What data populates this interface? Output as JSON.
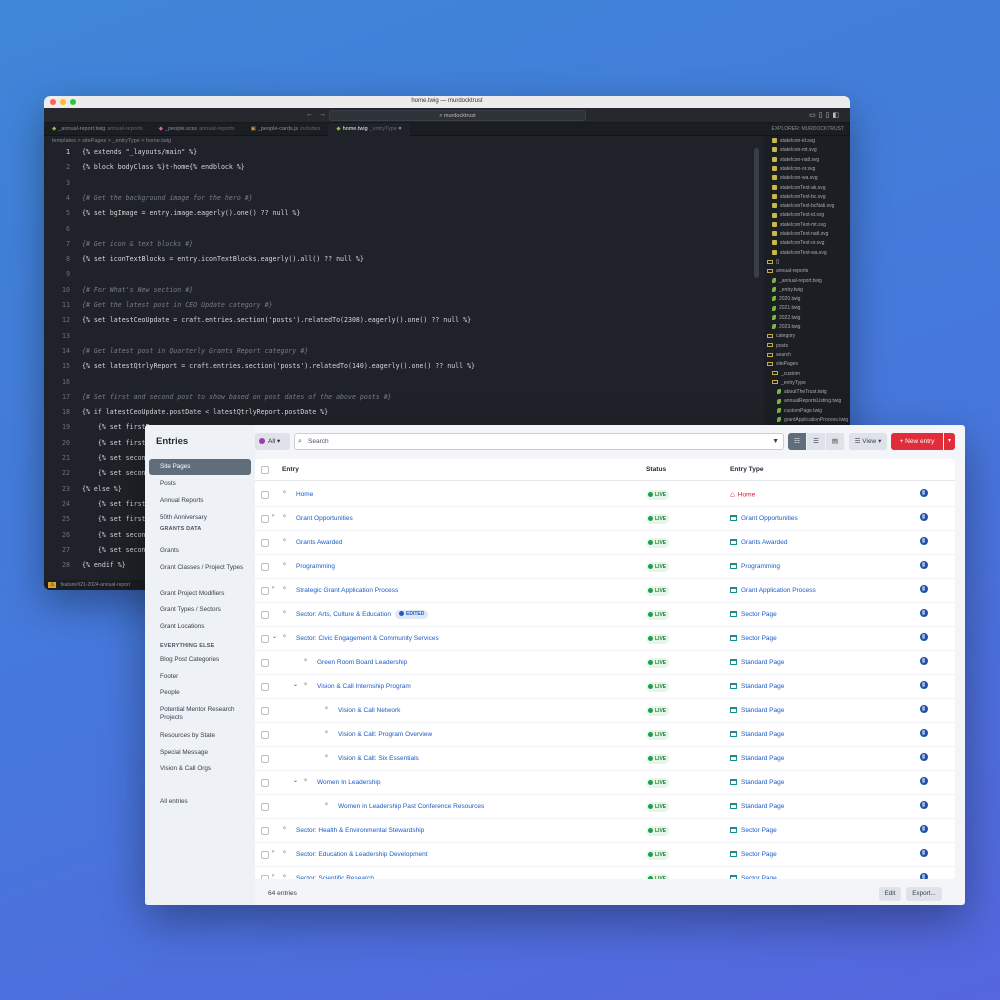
{
  "editor": {
    "window_title": "home.twig — murdocktrust",
    "search_text": "murdocktrust",
    "tabs": [
      {
        "name": "_annual-report.twig",
        "sub": "annual-reports"
      },
      {
        "name": "_people.scss",
        "sub": "annual-reports"
      },
      {
        "name": "_people-cards.js",
        "sub": "includes"
      },
      {
        "name": "home.twig",
        "sub": "_entryType"
      }
    ],
    "explorer_title": "EXPLORER: MURDOCKTRUST",
    "breadcrumb": "templates > sitePages > _entryType > home.twig",
    "code_lines": [
      {
        "n": "1",
        "t": "{% extends \"_layouts/main\" %}"
      },
      {
        "n": "2",
        "t": "{% block bodyClass %}t-home{% endblock %}"
      },
      {
        "n": "3",
        "t": ""
      },
      {
        "n": "4",
        "t": "{# Get the background image for the hero #}"
      },
      {
        "n": "5",
        "t": "{% set bgImage = entry.image.eagerly().one() ?? null %}"
      },
      {
        "n": "6",
        "t": ""
      },
      {
        "n": "7",
        "t": "{# Get icon & text blocks #}"
      },
      {
        "n": "8",
        "t": "{% set iconTextBlocks = entry.iconTextBlocks.eagerly().all() ?? null %}"
      },
      {
        "n": "9",
        "t": ""
      },
      {
        "n": "10",
        "t": "{# For What's New section #}"
      },
      {
        "n": "11",
        "t": "{# Get the latest post in CEO Update category #}"
      },
      {
        "n": "12",
        "t": "{% set latestCeoUpdate = craft.entries.section('posts').relatedTo(2308).eagerly().one() ?? null %}"
      },
      {
        "n": "13",
        "t": ""
      },
      {
        "n": "14",
        "t": "{# Get latest post in Quarterly Grants Report category #}"
      },
      {
        "n": "15",
        "t": "{% set latestQtrlyReport = craft.entries.section('posts').relatedTo(140).eagerly().one() ?? null %}"
      },
      {
        "n": "16",
        "t": ""
      },
      {
        "n": "17",
        "t": "{# Set first and second post to show based on post dates of the above posts #}"
      },
      {
        "n": "18",
        "t": "{% if latestCeoUpdate.postDate < latestQtrlyReport.postDate %}"
      },
      {
        "n": "19",
        "t": "    {% set firstP"
      },
      {
        "n": "20",
        "t": "    {% set firstP"
      },
      {
        "n": "21",
        "t": "    {% set second"
      },
      {
        "n": "22",
        "t": "    {% set second"
      },
      {
        "n": "23",
        "t": "{% else %}"
      },
      {
        "n": "24",
        "t": "    {% set firstP"
      },
      {
        "n": "25",
        "t": "    {% set firstP"
      },
      {
        "n": "26",
        "t": "    {% set second"
      },
      {
        "n": "27",
        "t": "    {% set second"
      },
      {
        "n": "28",
        "t": "{% endif %}"
      }
    ],
    "explorer_items": [
      {
        "label": "stateIcon-id.svg",
        "kind": "svg",
        "indent": 1
      },
      {
        "label": "stateIcon-mt.svg",
        "kind": "svg",
        "indent": 1
      },
      {
        "label": "stateIcon-natl.svg",
        "kind": "svg",
        "indent": 1
      },
      {
        "label": "stateIcon-or.svg",
        "kind": "svg",
        "indent": 1
      },
      {
        "label": "stateIcon-wa.svg",
        "kind": "svg",
        "indent": 1
      },
      {
        "label": "stateIconText-ak.svg",
        "kind": "svg",
        "indent": 1
      },
      {
        "label": "stateIconText-bc.svg",
        "kind": "svg",
        "indent": 1
      },
      {
        "label": "stateIconText-bcNati.svg",
        "kind": "svg",
        "indent": 1
      },
      {
        "label": "stateIconText-id.svg",
        "kind": "svg",
        "indent": 1
      },
      {
        "label": "stateIconText-mt.svg",
        "kind": "svg",
        "indent": 1
      },
      {
        "label": "stateIconText-natl.svg",
        "kind": "svg",
        "indent": 1
      },
      {
        "label": "stateIconText-or.svg",
        "kind": "svg",
        "indent": 1
      },
      {
        "label": "stateIconText-wa.svg",
        "kind": "svg",
        "indent": 1
      },
      {
        "label": "{}",
        "kind": "code",
        "indent": 0
      },
      {
        "label": "annual-reports",
        "kind": "folder",
        "indent": 0
      },
      {
        "label": "_annual-report.twig",
        "kind": "twig",
        "indent": 1
      },
      {
        "label": "_entry.twig",
        "kind": "twig",
        "indent": 1
      },
      {
        "label": "2020.twig",
        "kind": "twig",
        "indent": 1
      },
      {
        "label": "2021.twig",
        "kind": "twig",
        "indent": 1
      },
      {
        "label": "2022.twig",
        "kind": "twig",
        "indent": 1
      },
      {
        "label": "2023.twig",
        "kind": "twig",
        "indent": 1
      },
      {
        "label": "category",
        "kind": "folder",
        "indent": 0
      },
      {
        "label": "posts",
        "kind": "folder",
        "indent": 0
      },
      {
        "label": "search",
        "kind": "folder",
        "indent": 0
      },
      {
        "label": "sitePages",
        "kind": "folder",
        "indent": 0
      },
      {
        "label": "_custom",
        "kind": "folder",
        "indent": 1
      },
      {
        "label": "_entryType",
        "kind": "folder",
        "indent": 1
      },
      {
        "label": "aboutTheTrust.twig",
        "kind": "twig",
        "indent": 2
      },
      {
        "label": "annualReportsListing.twig",
        "kind": "twig",
        "indent": 2
      },
      {
        "label": "customPage.twig",
        "kind": "twig",
        "indent": 2
      },
      {
        "label": "grantApplicationProcess.twig",
        "kind": "twig",
        "indent": 2
      }
    ],
    "status_text": "feature/#21-2024-annual-report"
  },
  "cms": {
    "title": "Entries",
    "sidebar": {
      "items": [
        {
          "label": "Site Pages",
          "selected": true
        },
        {
          "label": "Posts"
        },
        {
          "label": "Annual Reports"
        },
        {
          "label": "50th Anniversary"
        }
      ],
      "group1_heading": "GRANTS DATA",
      "group1": [
        {
          "label": "Grants"
        },
        {
          "label": "Grant Classes / Project Types"
        },
        {
          "label": "Grant Project Modifiers"
        },
        {
          "label": "Grant Types / Sectors"
        },
        {
          "label": "Grant Locations"
        }
      ],
      "group2_heading": "EVERYTHING ELSE",
      "group2": [
        {
          "label": "Blog Post Categories"
        },
        {
          "label": "Footer"
        },
        {
          "label": "People"
        },
        {
          "label": "Potential Mentor Research Projects"
        },
        {
          "label": "Resources by State"
        },
        {
          "label": "Special Message"
        },
        {
          "label": "Vision & Call Orgs"
        }
      ],
      "all_entries": "All entries"
    },
    "toolbar": {
      "site_filter": "All",
      "search_placeholder": "Search",
      "view_label": "View",
      "new_entry_label": "New entry"
    },
    "table": {
      "columns": {
        "entry": "Entry",
        "status": "Status",
        "type": "Entry Type"
      },
      "rows": [
        {
          "title": "Home",
          "level": 0,
          "expand": "",
          "status": "LIVE",
          "type": "Home",
          "home": true
        },
        {
          "title": "Grant Opportunities",
          "level": 0,
          "expand": "›",
          "status": "LIVE",
          "type": "Grant Opportunities"
        },
        {
          "title": "Grants Awarded",
          "level": 0,
          "expand": "",
          "status": "LIVE",
          "type": "Grants Awarded"
        },
        {
          "title": "Programming",
          "level": 0,
          "expand": "",
          "status": "LIVE",
          "type": "Programming"
        },
        {
          "title": "Strategic Grant Application Process",
          "level": 0,
          "expand": "›",
          "status": "LIVE",
          "type": "Grant Application Process"
        },
        {
          "title": "Sector: Arts, Culture & Education",
          "level": 0,
          "expand": "",
          "status": "LIVE",
          "type": "Sector Page",
          "edited": "EDITED"
        },
        {
          "title": "Sector: Civic Engagement & Community Services",
          "level": 0,
          "expand": "⌄",
          "status": "LIVE",
          "type": "Sector Page"
        },
        {
          "title": "Green Room Board Leadership",
          "level": 1,
          "expand": "",
          "status": "LIVE",
          "type": "Standard Page"
        },
        {
          "title": "Vision & Call Internship Program",
          "level": 1,
          "expand": "⌄",
          "status": "LIVE",
          "type": "Standard Page"
        },
        {
          "title": "Vision & Call Network",
          "level": 2,
          "expand": "",
          "status": "LIVE",
          "type": "Standard Page"
        },
        {
          "title": "Vision & Call: Program Overview",
          "level": 2,
          "expand": "",
          "status": "LIVE",
          "type": "Standard Page"
        },
        {
          "title": "Vision & Call: Six Essentials",
          "level": 2,
          "expand": "",
          "status": "LIVE",
          "type": "Standard Page"
        },
        {
          "title": "Women In Leadership",
          "level": 1,
          "expand": "⌄",
          "status": "LIVE",
          "type": "Standard Page"
        },
        {
          "title": "Women in Leadership Past Conference Resources",
          "level": 2,
          "expand": "",
          "status": "LIVE",
          "type": "Standard Page"
        },
        {
          "title": "Sector: Health & Environmental Stewardship",
          "level": 0,
          "expand": "",
          "status": "LIVE",
          "type": "Sector Page"
        },
        {
          "title": "Sector: Education & Leadership Development",
          "level": 0,
          "expand": "›",
          "status": "LIVE",
          "type": "Sector Page"
        },
        {
          "title": "Sector: Scientific Research",
          "level": 0,
          "expand": "›",
          "status": "LIVE",
          "type": "Sector Page"
        }
      ]
    },
    "footer": {
      "count": "64 entries",
      "edit_label": "Edit",
      "export_label": "Export..."
    }
  }
}
